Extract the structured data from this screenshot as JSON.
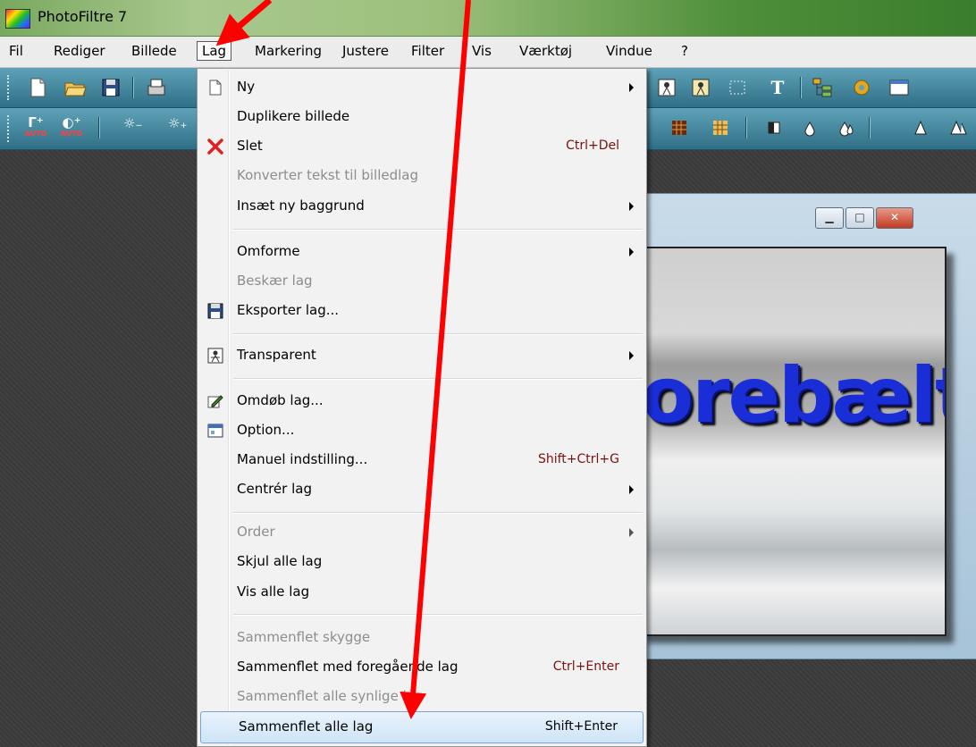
{
  "window": {
    "title": "PhotoFiltre 7"
  },
  "menubar": {
    "items": [
      {
        "label": "Fil"
      },
      {
        "label": "Rediger"
      },
      {
        "label": "Billede"
      },
      {
        "label": "Lag",
        "open": true
      },
      {
        "label": "Markering"
      },
      {
        "label": "Justere"
      },
      {
        "label": "Filter"
      },
      {
        "label": "Vis"
      },
      {
        "label": "Værktøj"
      },
      {
        "label": "Vindue"
      },
      {
        "label": "?"
      }
    ]
  },
  "toolbar": {
    "auto_label_1": "AUTO",
    "auto_label_2": "AUTO",
    "text_tool_label": "T"
  },
  "lag_menu": {
    "items": [
      {
        "label": "Ny",
        "shortcut": "",
        "submenu": true,
        "disabled": false,
        "icon": "new-page-icon"
      },
      {
        "label": "Duplikere billede",
        "shortcut": "",
        "submenu": false,
        "disabled": false,
        "icon": ""
      },
      {
        "label": "Slet",
        "shortcut": "Ctrl+Del",
        "submenu": false,
        "disabled": false,
        "icon": "red-x-icon"
      },
      {
        "label": "Konverter tekst til billedlag",
        "shortcut": "",
        "submenu": false,
        "disabled": true,
        "icon": ""
      },
      {
        "label": "Insæt ny baggrund",
        "shortcut": "",
        "submenu": true,
        "disabled": false,
        "icon": ""
      },
      {
        "label": "Omforme",
        "shortcut": "",
        "submenu": true,
        "disabled": false,
        "icon": ""
      },
      {
        "label": "Beskær lag",
        "shortcut": "",
        "submenu": false,
        "disabled": true,
        "icon": ""
      },
      {
        "label": "Eksporter lag...",
        "shortcut": "",
        "submenu": false,
        "disabled": false,
        "icon": "floppy-disk-icon"
      },
      {
        "label": "Transparent",
        "shortcut": "",
        "submenu": true,
        "disabled": false,
        "icon": "transparent-icon"
      },
      {
        "label": "Omdøb lag...",
        "shortcut": "",
        "submenu": false,
        "disabled": false,
        "icon": "rename-icon"
      },
      {
        "label": "Option...",
        "shortcut": "",
        "submenu": false,
        "disabled": false,
        "icon": "options-window-icon"
      },
      {
        "label": "Manuel indstilling...",
        "shortcut": "Shift+Ctrl+G",
        "submenu": false,
        "disabled": false,
        "icon": ""
      },
      {
        "label": "Centrér lag",
        "shortcut": "",
        "submenu": true,
        "disabled": false,
        "icon": ""
      },
      {
        "label": "Order",
        "shortcut": "",
        "submenu": true,
        "disabled": true,
        "icon": ""
      },
      {
        "label": "Skjul alle lag",
        "shortcut": "",
        "submenu": false,
        "disabled": false,
        "icon": ""
      },
      {
        "label": "Vis alle lag",
        "shortcut": "",
        "submenu": false,
        "disabled": false,
        "icon": ""
      },
      {
        "label": "Sammenflet skygge",
        "shortcut": "",
        "submenu": false,
        "disabled": true,
        "icon": ""
      },
      {
        "label": "Sammenflet med foregående lag",
        "shortcut": "Ctrl+Enter",
        "submenu": false,
        "disabled": false,
        "icon": ""
      },
      {
        "label": "Sammenflet alle synlige lag",
        "shortcut": "",
        "submenu": false,
        "disabled": true,
        "icon": ""
      },
      {
        "label": "Sammenflet alle lag",
        "shortcut": "Shift+Enter",
        "submenu": false,
        "disabled": false,
        "highlighted": true,
        "icon": ""
      }
    ]
  },
  "document": {
    "canvas_text": "orebælt"
  },
  "colors": {
    "annotation_arrow": "#ff0000",
    "menu_highlight": "#cfe4f7",
    "shortcut_text": "#7a1010",
    "canvas_text": "#1a2ed8"
  }
}
